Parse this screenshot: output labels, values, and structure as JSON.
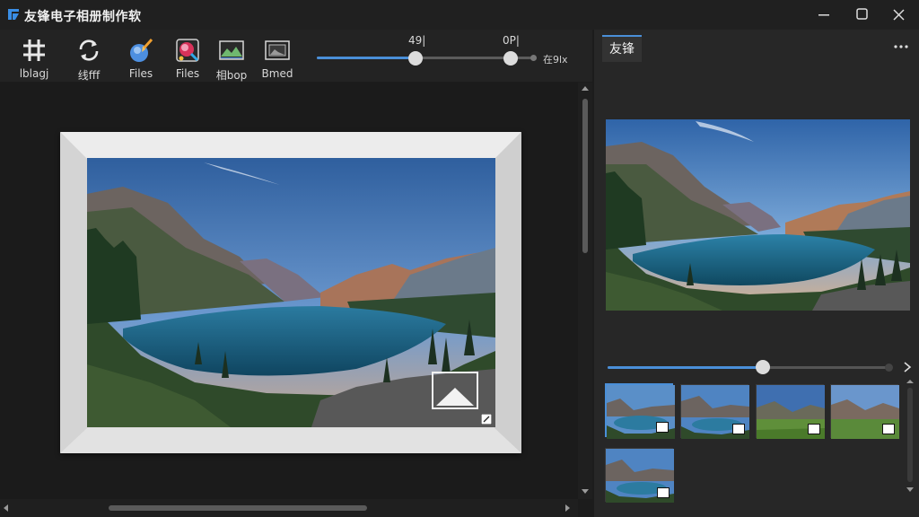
{
  "app": {
    "title": "友锋电子相册制作软"
  },
  "toolbar": {
    "tools": [
      {
        "label": "lblagj",
        "icon": "grid-hash-icon"
      },
      {
        "label": "线fff",
        "icon": "refresh-icon"
      },
      {
        "label": "Files",
        "icon": "paint-brush-icon"
      },
      {
        "label": "Files",
        "icon": "effects-icon"
      },
      {
        "label": "相bop",
        "icon": "landscape-image-icon"
      },
      {
        "label": "Bmed",
        "icon": "frame-image-icon"
      }
    ],
    "slider": {
      "value_a_label": "49|",
      "value_b_label": "0P|",
      "end_label": "在9lx",
      "value_a": 0.45,
      "value_b": 0.88
    }
  },
  "right_panel": {
    "tab_label": "友锋",
    "slider": {
      "value": 0.55
    }
  },
  "colors": {
    "accent": "#4a8fd8",
    "background": "#1c1c1c",
    "panel": "#272727"
  }
}
